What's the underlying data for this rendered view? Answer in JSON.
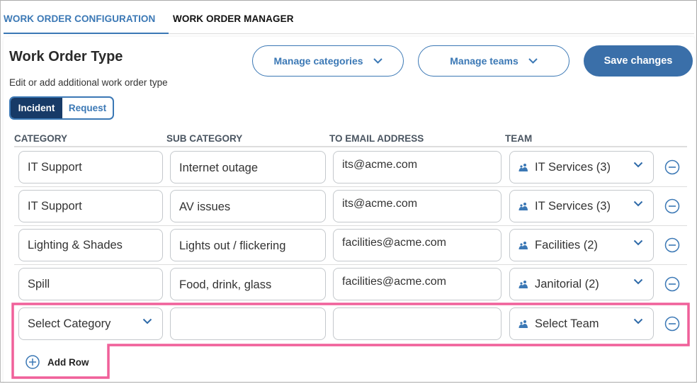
{
  "tabs": [
    {
      "label": "WORK ORDER CONFIGURATION",
      "active": true
    },
    {
      "label": "WORK ORDER MANAGER",
      "active": false
    }
  ],
  "page": {
    "title": "Work Order Type",
    "subtitle": "Edit or add additional work order type"
  },
  "toolbar": {
    "manage_categories": "Manage categories",
    "manage_teams": "Manage teams",
    "save": "Save changes"
  },
  "type_toggle": {
    "options": [
      "Incident",
      "Request"
    ],
    "selected": "Incident"
  },
  "columns": [
    "CATEGORY",
    "SUB CATEGORY",
    "TO EMAIL ADDRESS",
    "TEAM"
  ],
  "rows": [
    {
      "category": "IT Support",
      "sub_category": "Internet outage",
      "email": "its@acme.com",
      "team": "IT Services (3)"
    },
    {
      "category": "IT Support",
      "sub_category": "AV issues",
      "email": "its@acme.com",
      "team": "IT Services (3)"
    },
    {
      "category": "Lighting & Shades",
      "sub_category": "Lights out / flickering",
      "email": "facilities@acme.com",
      "team": "Facilities (2)"
    },
    {
      "category": "Spill",
      "sub_category": "Food, drink, glass",
      "email": "facilities@acme.com",
      "team": "Janitorial (2)"
    },
    {
      "category": "Select Category",
      "sub_category": "",
      "email": "",
      "team": "Select Team"
    }
  ],
  "add_row": "Add Row",
  "colors": {
    "accent": "#3b78b5",
    "dark": "#173a67",
    "highlight": "#f0609a"
  }
}
